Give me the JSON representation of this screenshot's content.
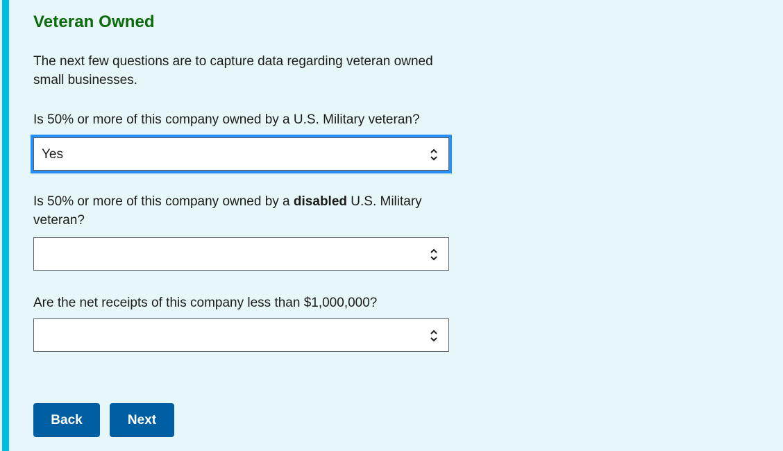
{
  "section": {
    "title": "Veteran Owned",
    "intro": "The next few questions are to capture data regarding veteran owned small businesses."
  },
  "questions": [
    {
      "label": "Is 50% or more of this company owned by a U.S. Military veteran?",
      "value": "Yes",
      "focused": true
    },
    {
      "label_before": "Is 50% or more of this company owned by a ",
      "label_bold": "disabled",
      "label_after": " U.S. Military veteran?",
      "value": ""
    },
    {
      "label": "Are the net receipts of this company less than $1,000,000?",
      "value": ""
    }
  ],
  "buttons": {
    "back": "Back",
    "next": "Next"
  },
  "icons": {
    "select_indicator": "unfold-chevron-icon"
  },
  "colors": {
    "background": "#e7f6f8",
    "accent_bar": "#00bde3",
    "heading": "#0b6a0b",
    "primary_button": "#005ea2",
    "focus_ring": "#2491ff"
  }
}
